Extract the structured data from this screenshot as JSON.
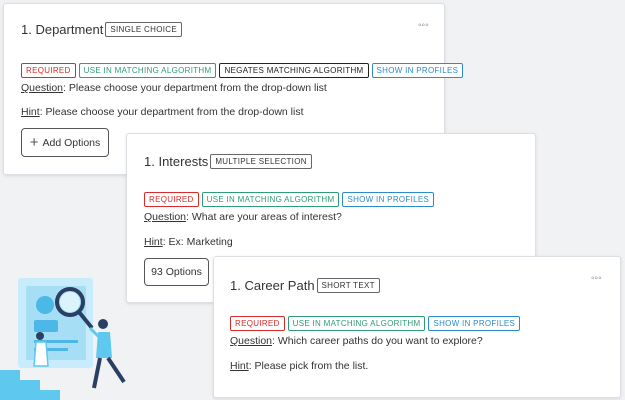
{
  "cards": [
    {
      "title": "1. Department",
      "type_badge": "SINGLE CHOICE",
      "more_icon": "more-icon",
      "tags": {
        "required": "REQUIRED",
        "matching": "USE IN MATCHING ALGORITHM",
        "negates": "NEGATES MATCHING ALGORITHM",
        "profiles": "SHOW IN PROFILES"
      },
      "question_label": "Question",
      "question_text": ": Please choose your department from the drop-down list",
      "hint_label": "Hint",
      "hint_text": ": Please choose your department from the drop-down list",
      "options_button": "Add Options"
    },
    {
      "title": "1. Interests",
      "type_badge": "MULTIPLE SELECTION",
      "tags": {
        "required": "REQUIRED",
        "matching": "USE IN MATCHING ALGORITHM",
        "profiles": "SHOW IN PROFILES"
      },
      "question_label": "Question",
      "question_text": ": What are your areas of interest?",
      "hint_label": "Hint",
      "hint_text": ": Ex: Marketing",
      "options_button": "93 Options"
    },
    {
      "title": "1. Career Path",
      "type_badge": "SHORT TEXT",
      "more_icon": "more-icon",
      "tags": {
        "required": "REQUIRED",
        "matching": "USE IN MATCHING ALGORITHM",
        "profiles": "SHOW IN PROFILES"
      },
      "question_label": "Question",
      "question_text": ": Which career paths do you want to explore?",
      "hint_label": "Hint",
      "hint_text": ": Please pick from the list."
    }
  ],
  "colors": {
    "required": "#d92b2b",
    "matching": "#2e9c74",
    "negates": "#222222",
    "profiles": "#2d8bc9",
    "illustration_blue": "#5ec8ef"
  },
  "illustration": "person-with-magnifier-illustration"
}
